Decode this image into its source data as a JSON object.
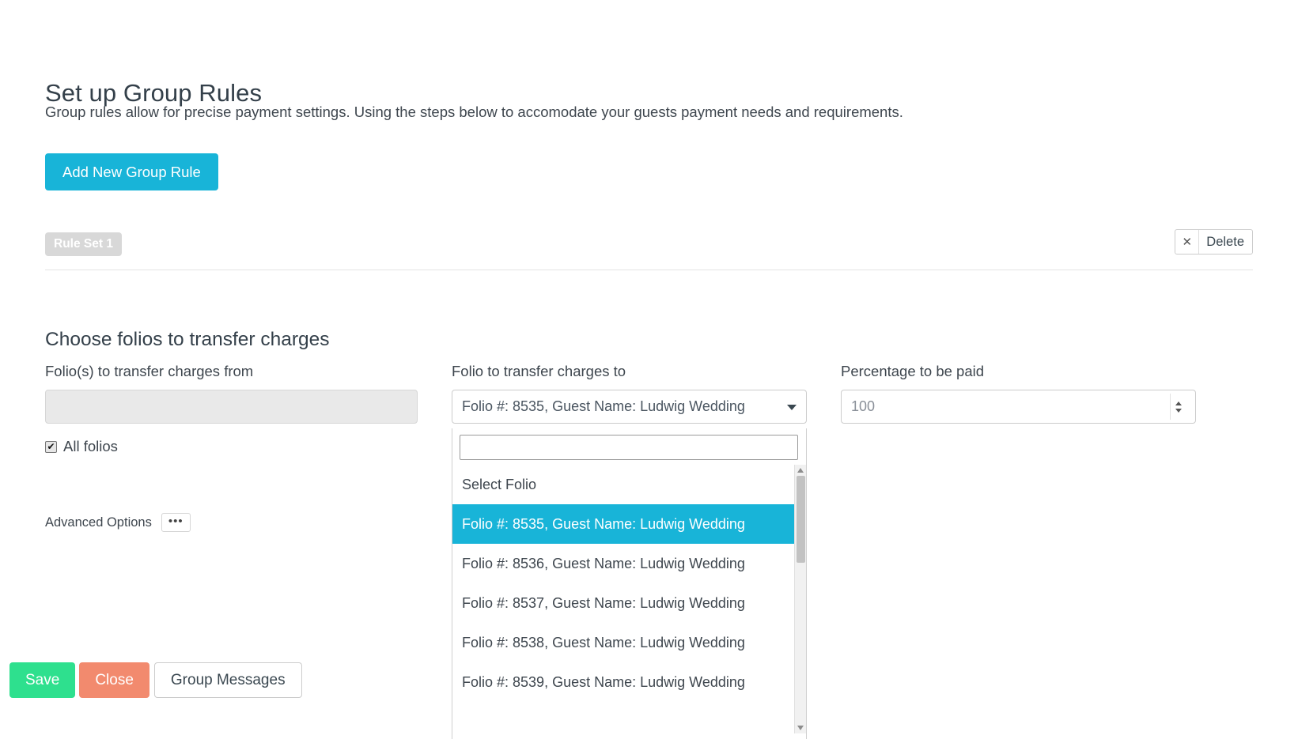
{
  "header": {
    "title": "Set up Group Rules",
    "subtitle": "Group rules allow for precise payment settings. Using the steps below to accomodate your guests payment needs and requirements.",
    "add_rule_label": "Add New Group Rule"
  },
  "rule_set": {
    "badge_label": "Rule Set 1",
    "delete_icon": "close-x-icon",
    "delete_label": "Delete"
  },
  "section": {
    "title": "Choose folios to transfer charges"
  },
  "fields": {
    "from": {
      "label": "Folio(s) to transfer charges from",
      "value": "",
      "placeholder": ""
    },
    "to": {
      "label": "Folio to transfer charges to",
      "selected": "Folio #: 8535, Guest Name: Ludwig Wedding",
      "caret_icon": "chevron-down-icon",
      "search_value": "",
      "search_placeholder": "",
      "options": [
        "Select Folio",
        "Folio #: 8535, Guest Name: Ludwig Wedding",
        "Folio #: 8536, Guest Name: Ludwig Wedding",
        "Folio #: 8537, Guest Name: Ludwig Wedding",
        "Folio #: 8538, Guest Name: Ludwig Wedding",
        "Folio #: 8539, Guest Name: Ludwig Wedding"
      ],
      "selected_index": 1
    },
    "percentage": {
      "label": "Percentage to be paid",
      "value": "100",
      "placeholder": "100",
      "spinner_up_icon": "spinner-up-icon",
      "spinner_down_icon": "spinner-down-icon"
    }
  },
  "all_folios": {
    "label": "All folios",
    "checked": true,
    "check_glyph": "✔"
  },
  "advanced": {
    "label": "Advanced Options",
    "button_label": "•••"
  },
  "footer": {
    "save_label": "Save",
    "close_label": "Close",
    "group_messages_label": "Group Messages"
  },
  "colors": {
    "accent": "#18b4d8",
    "save": "#2ee08e",
    "close": "#f28a6e",
    "badge": "#d8d8d8"
  }
}
